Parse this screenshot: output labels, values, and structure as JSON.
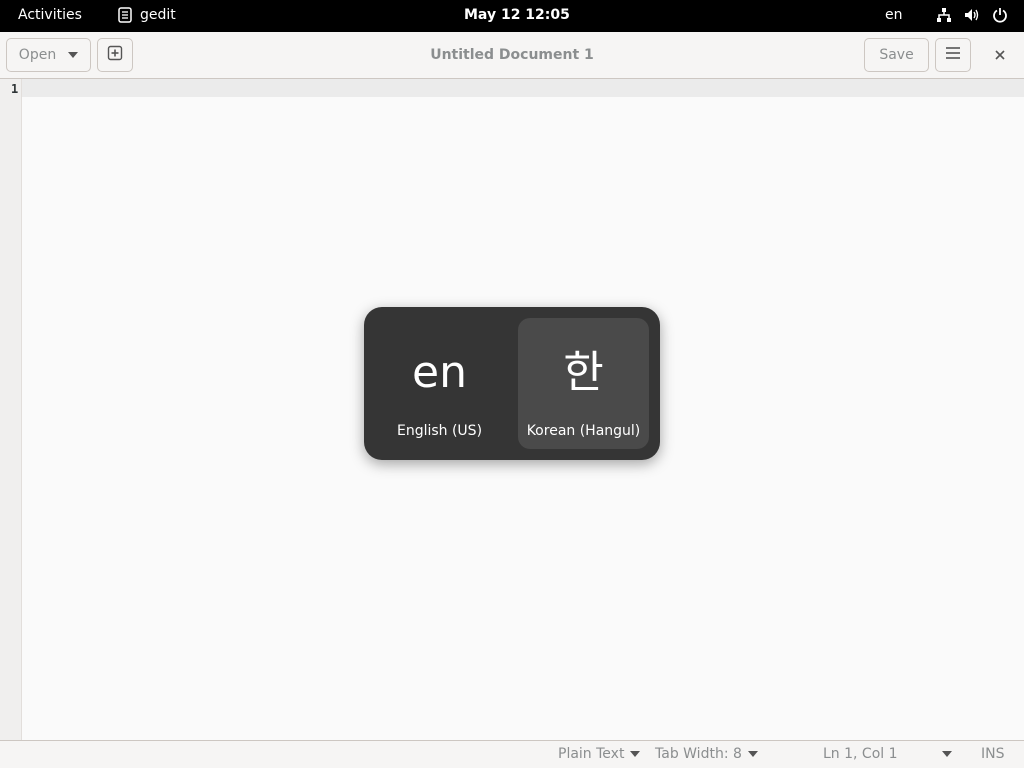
{
  "topbar": {
    "activities": "Activities",
    "app_name": "gedit",
    "clock": "May 12  12:05",
    "input_indicator": "en"
  },
  "headerbar": {
    "open_label": "Open",
    "title": "Untitled Document 1",
    "save_label": "Save"
  },
  "editor": {
    "line_number": "1"
  },
  "statusbar": {
    "language": "Plain Text",
    "tab_width": "Tab Width: 8",
    "position": "Ln 1, Col 1",
    "mode": "INS"
  },
  "input_switcher": {
    "sources": [
      {
        "short": "en",
        "name": "English (US)",
        "selected": false
      },
      {
        "short": "한",
        "name": "Korean (Hangul)",
        "selected": true
      }
    ]
  }
}
